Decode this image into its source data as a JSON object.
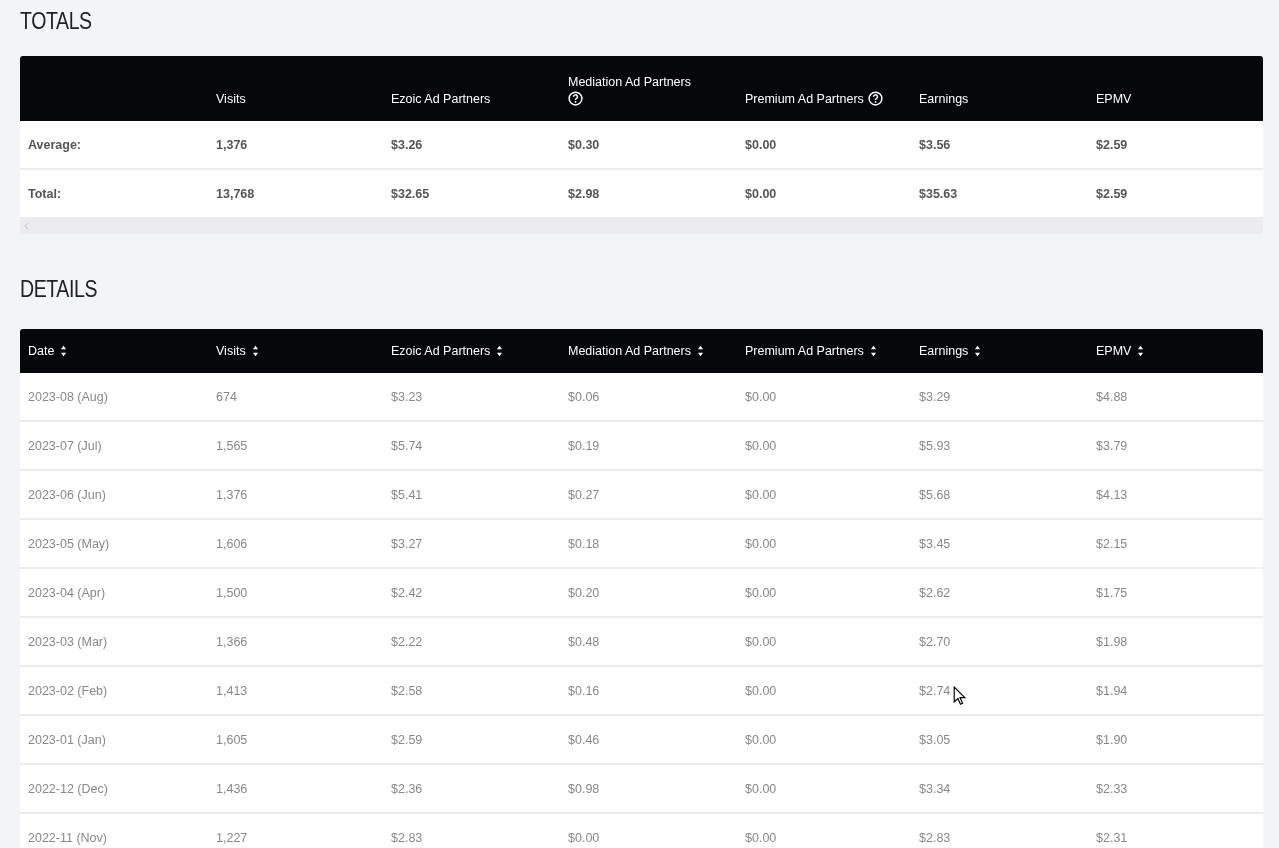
{
  "totals": {
    "title": "TOTALS",
    "columns": [
      null,
      {
        "label": "Visits",
        "help": false
      },
      {
        "label": "Ezoic Ad Partners",
        "help": false
      },
      {
        "label": "Mediation Ad Partners",
        "help": true
      },
      {
        "label": "Premium Ad Partners",
        "help": true
      },
      {
        "label": "Earnings",
        "help": false
      },
      {
        "label": "EPMV",
        "help": false
      }
    ],
    "rows": [
      [
        "Average:",
        "1,376",
        "$3.26",
        "$0.30",
        "$0.00",
        "$3.56",
        "$2.59"
      ],
      [
        "Total:",
        "13,768",
        "$32.65",
        "$2.98",
        "$0.00",
        "$35.63",
        "$2.59"
      ]
    ]
  },
  "details": {
    "title": "DETAILS",
    "columns": [
      {
        "label": "Date",
        "sortable": true
      },
      {
        "label": "Visits",
        "sortable": true
      },
      {
        "label": "Ezoic Ad Partners",
        "sortable": true
      },
      {
        "label": "Mediation Ad Partners",
        "sortable": true
      },
      {
        "label": "Premium Ad Partners",
        "sortable": true
      },
      {
        "label": "Earnings",
        "sortable": true
      },
      {
        "label": "EPMV",
        "sortable": true
      }
    ],
    "rows": [
      [
        "2023-08 (Aug)",
        "674",
        "$3.23",
        "$0.06",
        "$0.00",
        "$3.29",
        "$4.88"
      ],
      [
        "2023-07 (Jul)",
        "1,565",
        "$5.74",
        "$0.19",
        "$0.00",
        "$5.93",
        "$3.79"
      ],
      [
        "2023-06 (Jun)",
        "1,376",
        "$5.41",
        "$0.27",
        "$0.00",
        "$5.68",
        "$4.13"
      ],
      [
        "2023-05 (May)",
        "1,606",
        "$3.27",
        "$0.18",
        "$0.00",
        "$3.45",
        "$2.15"
      ],
      [
        "2023-04 (Apr)",
        "1,500",
        "$2.42",
        "$0.20",
        "$0.00",
        "$2.62",
        "$1.75"
      ],
      [
        "2023-03 (Mar)",
        "1,366",
        "$2.22",
        "$0.48",
        "$0.00",
        "$2.70",
        "$1.98"
      ],
      [
        "2023-02 (Feb)",
        "1,413",
        "$2.58",
        "$0.16",
        "$0.00",
        "$2.74",
        "$1.94"
      ],
      [
        "2023-01 (Jan)",
        "1,605",
        "$2.59",
        "$0.46",
        "$0.00",
        "$3.05",
        "$1.90"
      ],
      [
        "2022-12 (Dec)",
        "1,436",
        "$2.36",
        "$0.98",
        "$0.00",
        "$3.34",
        "$2.33"
      ],
      [
        "2022-11 (Nov)",
        "1,227",
        "$2.83",
        "$0.00",
        "$0.00",
        "$2.83",
        "$2.31"
      ]
    ]
  }
}
